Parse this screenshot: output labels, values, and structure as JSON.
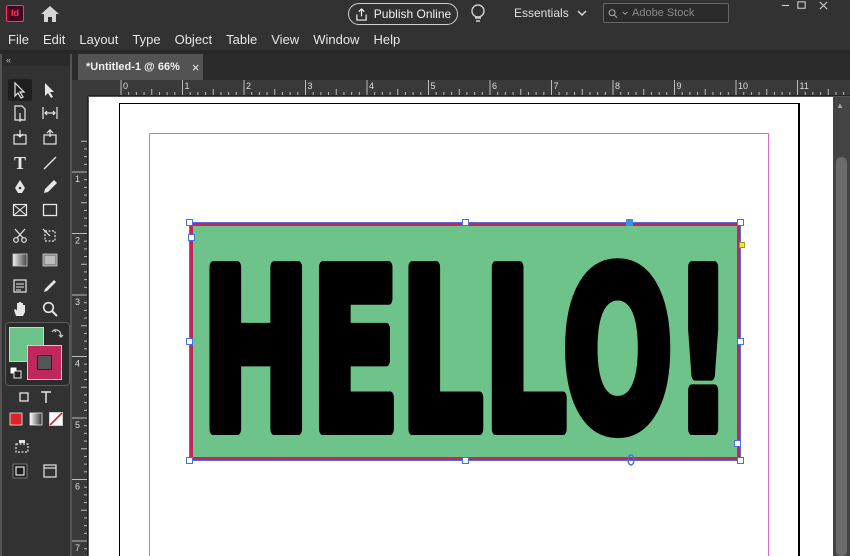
{
  "app": {
    "icon_label": "Id",
    "publish_label": "Publish Online",
    "workspace_label": "Essentials",
    "search_placeholder": "Adobe Stock"
  },
  "menu": [
    "File",
    "Edit",
    "Layout",
    "Type",
    "Object",
    "Table",
    "View",
    "Window",
    "Help"
  ],
  "document": {
    "tab_label": "*Untitled-1 @ 66%",
    "close_glyph": "×",
    "text_content": "HELLO!"
  },
  "rulers": {
    "horizontal": [
      "0",
      "1",
      "2",
      "3",
      "4",
      "5",
      "6",
      "7",
      "8",
      "9",
      "10",
      "11"
    ],
    "vertical": [
      "1",
      "2",
      "3",
      "4",
      "5",
      "6",
      "7"
    ]
  },
  "colors": {
    "fill": "#6ec38a",
    "stroke": "#c0275d",
    "text": "#000000",
    "selection": "#4a6fe0"
  },
  "toolbox": {
    "collapse_glyph": "«",
    "text_tool_label": "T"
  }
}
